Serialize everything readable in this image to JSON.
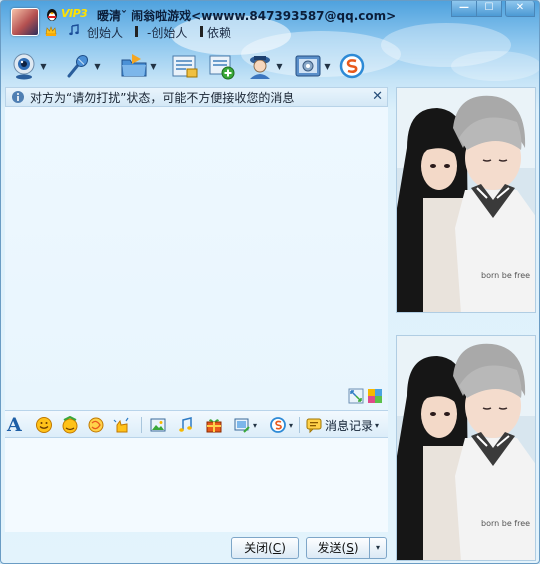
{
  "title": {
    "vip_label": "VIP3",
    "name": "暧清ˇ 闹翁啦游戏<wwww.847393587@qq.com>",
    "signature_parts": [
      "创始人",
      "-创始人",
      "依赖"
    ]
  },
  "window_buttons": {
    "minimize": "—",
    "maximize": "☐",
    "close": "✕"
  },
  "toolbar": {
    "items": [
      {
        "icon": "webcam-icon",
        "has_dropdown": true
      },
      {
        "icon": "microphone-icon",
        "has_dropdown": true
      },
      {
        "icon": "folder-transfer-icon",
        "has_dropdown": true
      },
      {
        "icon": "email-icon",
        "has_dropdown": false
      },
      {
        "icon": "add-contact-icon",
        "has_dropdown": false
      },
      {
        "icon": "user-info-icon",
        "has_dropdown": true
      },
      {
        "icon": "app-settings-icon",
        "has_dropdown": true
      },
      {
        "icon": "soso-icon",
        "has_dropdown": false
      }
    ]
  },
  "notice": {
    "text": "对方为“请勿打扰”状态，可能不方便接收您的消息",
    "close": "✕"
  },
  "format_toolbar": {
    "font_label": "A",
    "history_label": "消息记录",
    "dropdown_arrow": "▾"
  },
  "buttons": {
    "close_label": "关闭(",
    "close_key": "C",
    "close_tail": ")",
    "send_label": "发送(",
    "send_key": "S",
    "send_tail": ")",
    "send_menu": "▾"
  },
  "colors": {
    "titlebar": "#4fa2de",
    "accent": "#1f5fa6",
    "vip": "#ffe200"
  }
}
